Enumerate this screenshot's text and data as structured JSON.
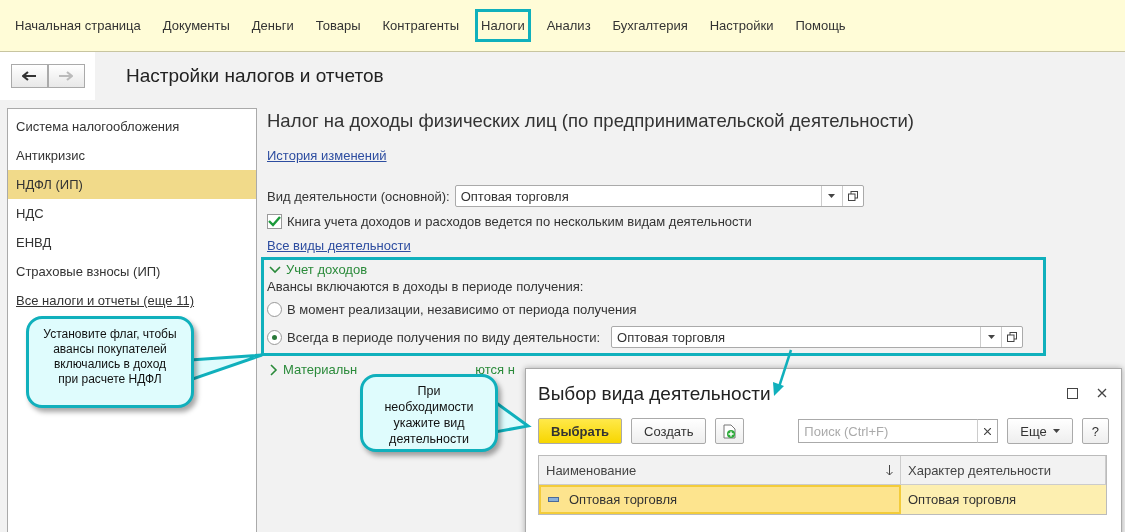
{
  "menu": [
    {
      "label": "Начальная страница",
      "selected": false
    },
    {
      "label": "Документы",
      "selected": false
    },
    {
      "label": "Деньги",
      "selected": false
    },
    {
      "label": "Товары",
      "selected": false
    },
    {
      "label": "Контрагенты",
      "selected": false
    },
    {
      "label": "Налоги",
      "selected": true
    },
    {
      "label": "Анализ",
      "selected": false
    },
    {
      "label": "Бухгалтерия",
      "selected": false
    },
    {
      "label": "Настройки",
      "selected": false
    },
    {
      "label": "Помощь",
      "selected": false
    }
  ],
  "nav": {
    "back_disabled": false,
    "forward_disabled": true
  },
  "page_title": "Настройки налогов и отчетов",
  "sidebar": {
    "items": [
      {
        "label": "Система налогообложения",
        "selected": false
      },
      {
        "label": "Антикризис",
        "selected": false
      },
      {
        "label": "НДФЛ (ИП)",
        "selected": true
      },
      {
        "label": "НДС",
        "selected": false
      },
      {
        "label": "ЕНВД",
        "selected": false
      },
      {
        "label": "Страховые взносы (ИП)",
        "selected": false
      }
    ],
    "link": "Все налоги и отчеты (еще 11)"
  },
  "content": {
    "title": "Налог на доходы физических лиц (по предпринимательской деятельности)",
    "history_link": "История изменений",
    "activity_field": {
      "label": "Вид деятельности (основной):",
      "value": "Оптовая торговля"
    },
    "multi_checkbox": {
      "label": "Книга учета доходов и расходов ведется по нескольким видам деятельности",
      "checked": true
    },
    "all_activities_link": "Все виды деятельности",
    "income_group": {
      "title": "Учет доходов",
      "expanded": true,
      "prompt": "Авансы включаются в доходы в периоде получения:",
      "options": [
        {
          "label": "В момент реализации, независимо от периода получения",
          "selected": false
        },
        {
          "label": "Всегда в периоде получения по виду деятельности:",
          "selected": true,
          "value": "Оптовая торговля"
        }
      ]
    },
    "material_group": {
      "title_start": "Материальн",
      "title_end": "ются н",
      "expanded": false
    }
  },
  "callouts": [
    {
      "text": "Установите флаг, чтобы авансы покупателей включались в доход при расчете НДФЛ"
    },
    {
      "text": "При необходимости укажите вид деятельности"
    }
  ],
  "dialog": {
    "title": "Выбор вида деятельности",
    "buttons": {
      "select": "Выбрать",
      "create": "Создать",
      "more": "Еще",
      "help": "?"
    },
    "search": {
      "placeholder": "Поиск (Ctrl+F)"
    },
    "columns": [
      "Наименование",
      "Характер деятельности"
    ],
    "rows": [
      {
        "cells": [
          "Оптовая торговля",
          "Оптовая торговля"
        ],
        "selected": true
      }
    ]
  }
}
